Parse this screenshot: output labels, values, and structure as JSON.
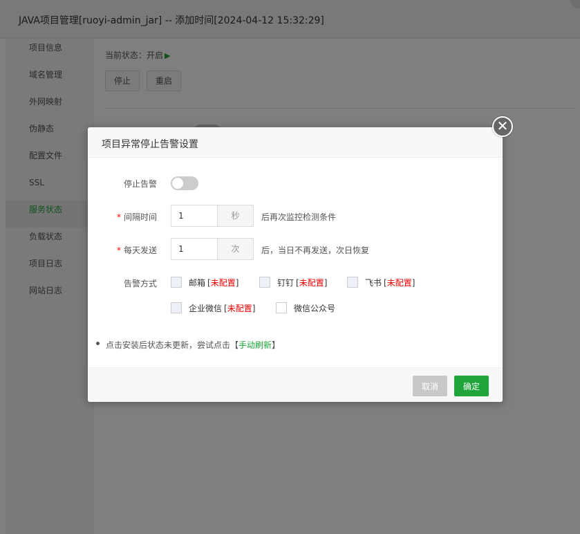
{
  "window": {
    "title": "JAVA项目管理[ruoyi-admin_jar] -- 添加时间[2024-04-12 15:32:29]"
  },
  "sidebar": {
    "items": [
      {
        "label": "项目信息",
        "active": false
      },
      {
        "label": "域名管理",
        "active": false
      },
      {
        "label": "外网映射",
        "active": false
      },
      {
        "label": "伪静态",
        "active": false
      },
      {
        "label": "配置文件",
        "active": false
      },
      {
        "label": "SSL",
        "active": false
      },
      {
        "label": "服务状态",
        "active": true
      },
      {
        "label": "负载状态",
        "active": false
      },
      {
        "label": "项目日志",
        "active": false
      },
      {
        "label": "网站日志",
        "active": false
      }
    ]
  },
  "main": {
    "status_label": "当前状态：",
    "status_value": "开启",
    "status_icon": "play-icon",
    "stop_label": "停止",
    "restart_label": "重启"
  },
  "dialog": {
    "title": "项目异常停止告警设置",
    "close_icon": "close-icon",
    "stop_alert_label": "停止告警",
    "stop_alert_on": false,
    "interval": {
      "label": "间隔时间",
      "value": "1",
      "unit": "秒",
      "hint": "后再次监控检测条件"
    },
    "daily": {
      "label": "每天发送",
      "value": "1",
      "unit": "次",
      "hint": "后，当日不再发送，次日恢复"
    },
    "method_label": "告警方式",
    "methods": [
      {
        "label": "邮箱",
        "bracket_open": "[",
        "status": "未配置",
        "bracket_close": "]",
        "checked": false
      },
      {
        "label": "钉钉",
        "bracket_open": "[",
        "status": "未配置",
        "bracket_close": "]",
        "checked": false
      },
      {
        "label": "飞书",
        "bracket_open": "[",
        "status": "未配置",
        "bracket_close": "]",
        "checked": false
      },
      {
        "label": "企业微信",
        "bracket_open": "[",
        "status": "未配置",
        "bracket_close": "]",
        "checked": false
      },
      {
        "label": "微信公众号",
        "checked": false
      }
    ],
    "note_prefix": "点击安装后状态未更新，尝试点击【",
    "note_link": "手动刷新",
    "note_suffix": "】",
    "cancel_label": "取消",
    "confirm_label": "确定"
  },
  "colors": {
    "accent": "#20a53a",
    "warning": "#e00000",
    "overlay": "rgba(0,0,0,0.5)"
  }
}
